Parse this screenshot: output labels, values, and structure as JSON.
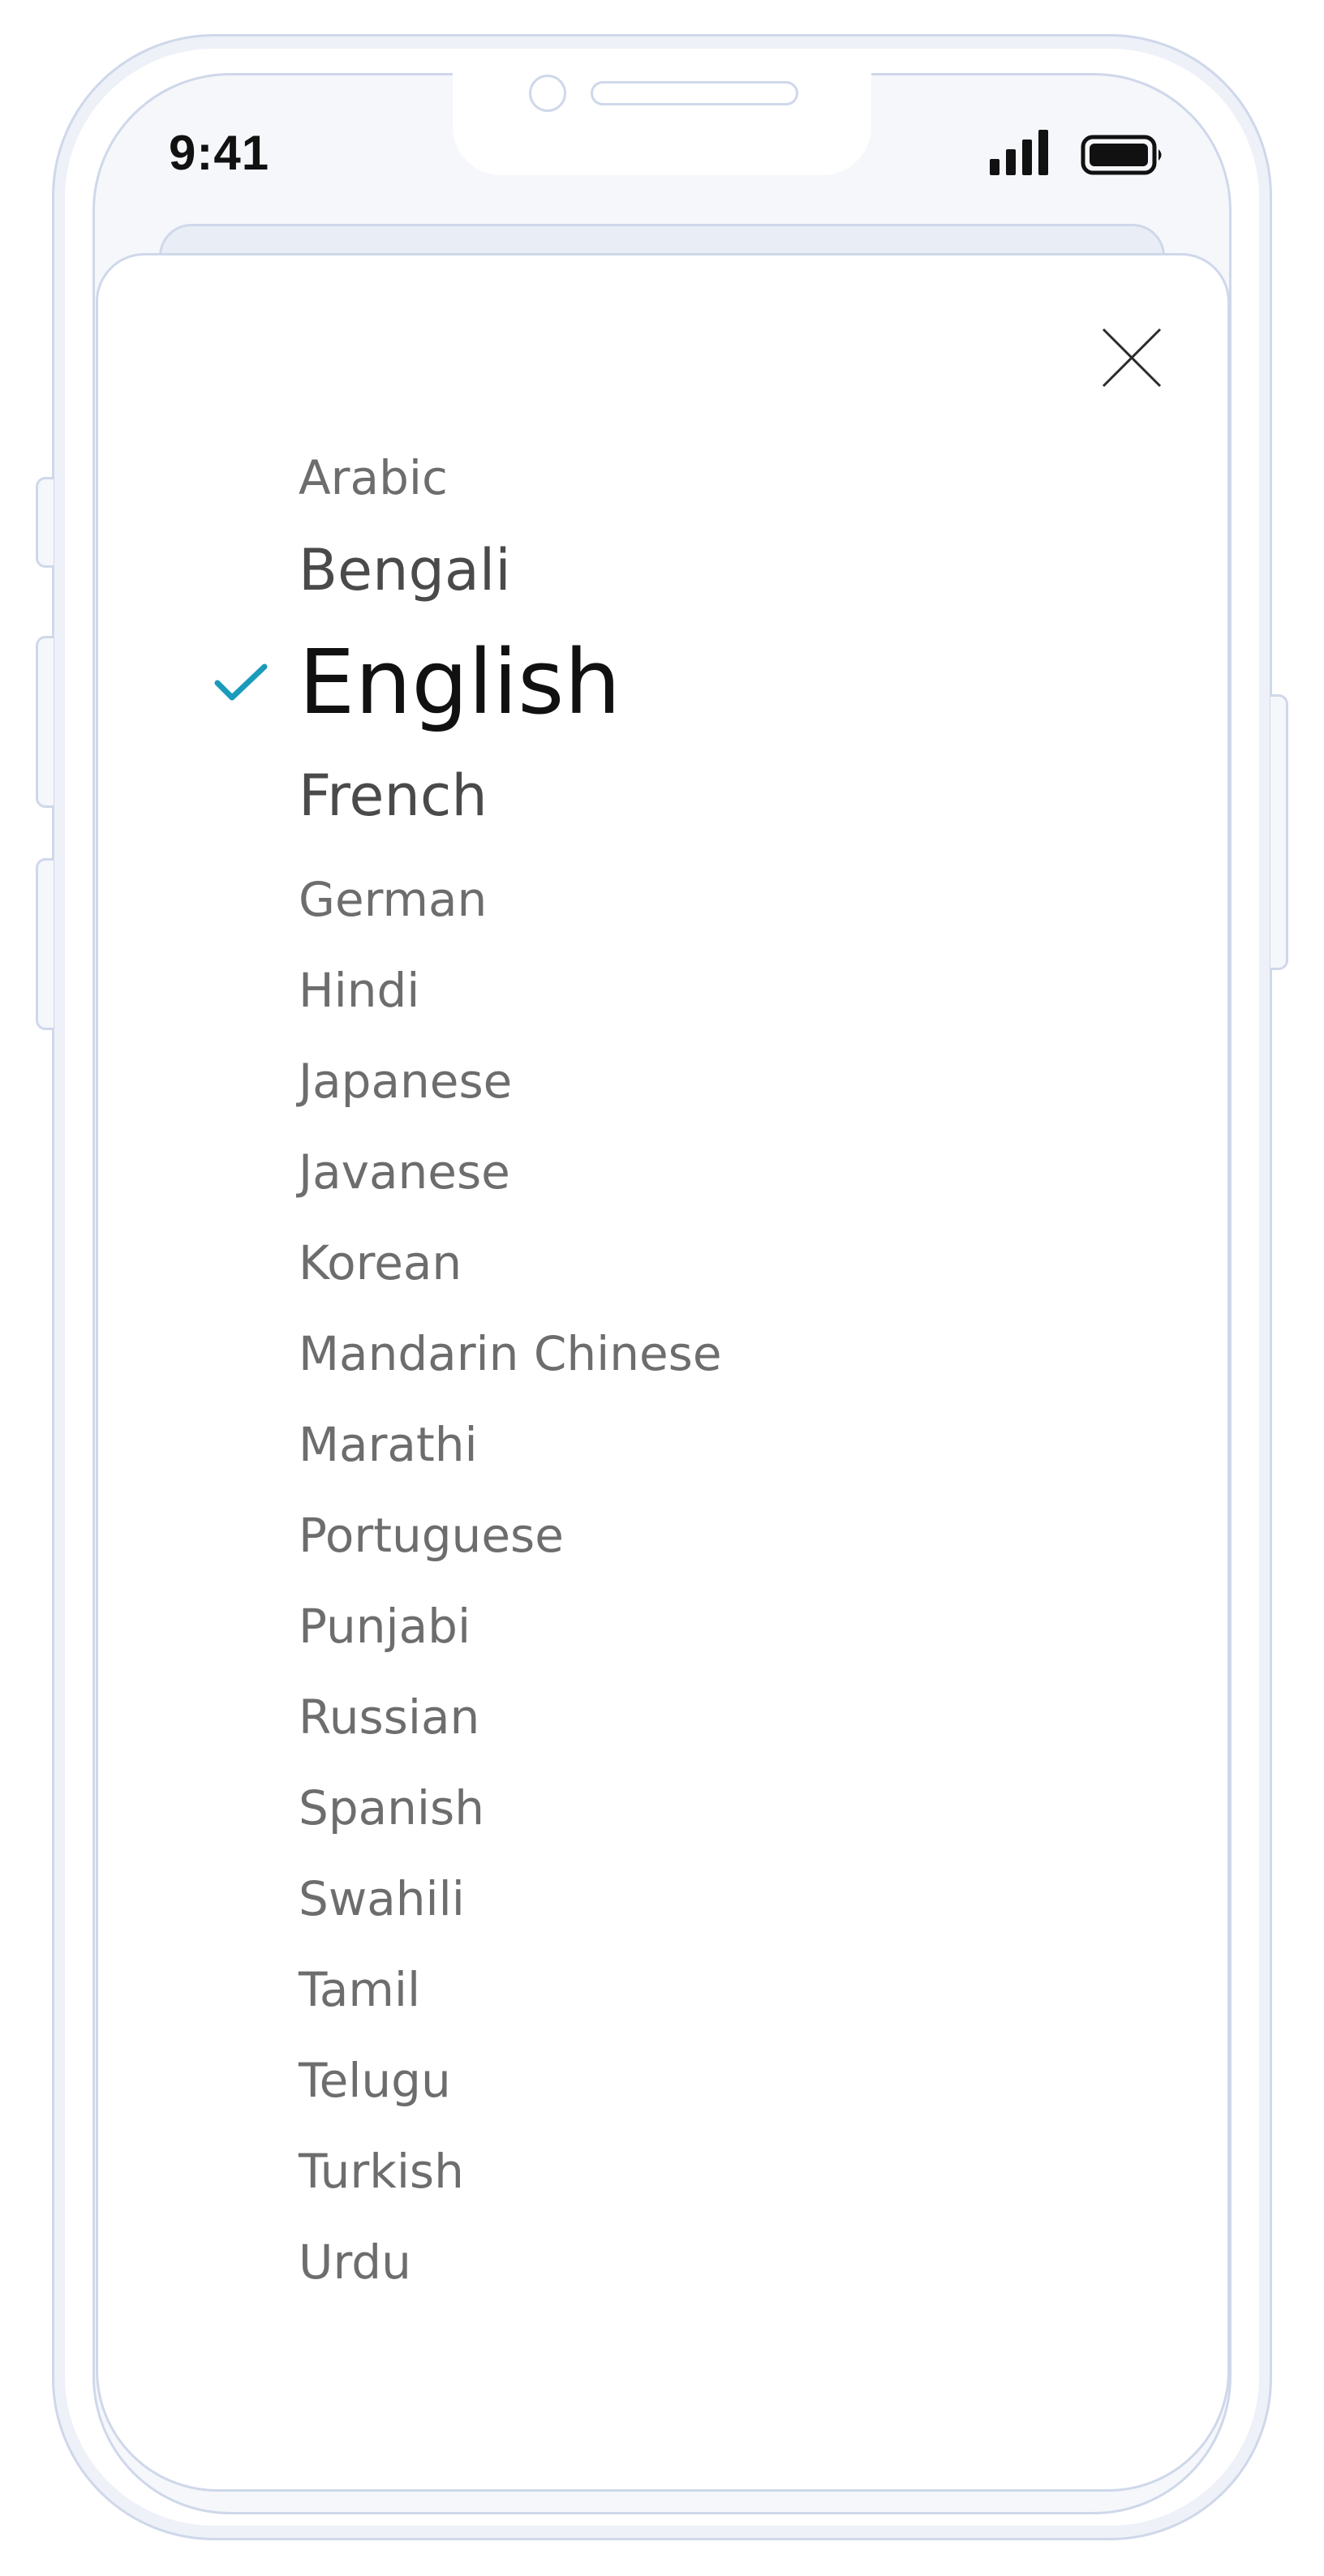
{
  "status_bar": {
    "time": "9:41"
  },
  "language_picker": {
    "selected": "English",
    "accent_color": "#1a9bbb",
    "items": [
      {
        "label": "Arabic"
      },
      {
        "label": "Bengali"
      },
      {
        "label": "English"
      },
      {
        "label": "French"
      },
      {
        "label": "German"
      },
      {
        "label": "Hindi"
      },
      {
        "label": "Japanese"
      },
      {
        "label": "Javanese"
      },
      {
        "label": "Korean"
      },
      {
        "label": "Mandarin Chinese"
      },
      {
        "label": "Marathi"
      },
      {
        "label": "Portuguese"
      },
      {
        "label": "Punjabi"
      },
      {
        "label": "Russian"
      },
      {
        "label": "Spanish"
      },
      {
        "label": "Swahili"
      },
      {
        "label": "Tamil"
      },
      {
        "label": "Telugu"
      },
      {
        "label": "Turkish"
      },
      {
        "label": "Urdu"
      }
    ]
  },
  "icons": {
    "close": "close-icon",
    "check": "checkmark-icon",
    "signal": "cellular-signal-icon",
    "battery": "battery-icon"
  }
}
